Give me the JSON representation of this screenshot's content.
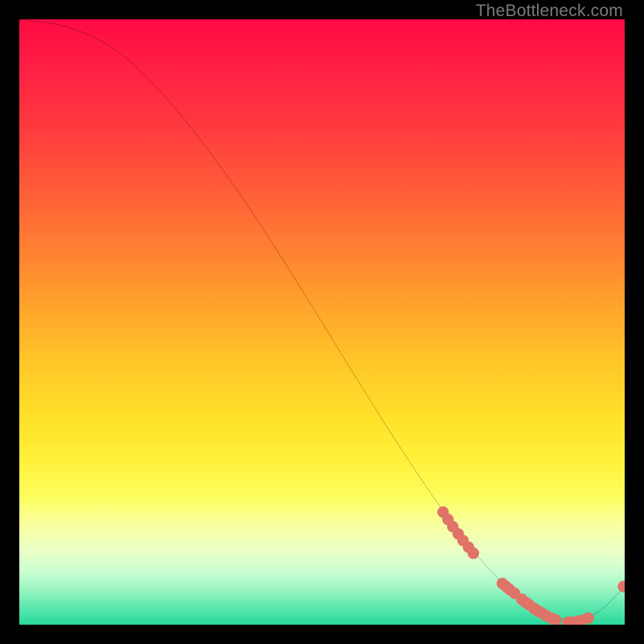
{
  "watermark": "TheBottleneck.com",
  "chart_data": {
    "type": "line",
    "title": "",
    "xlabel": "",
    "ylabel": "",
    "xlim": [
      0,
      100
    ],
    "ylim": [
      0,
      100
    ],
    "grid": false,
    "note": "Axes have no tick labels; values are estimated in 0–100 plot-percent coordinates.",
    "series": [
      {
        "name": "bottleneck-curve",
        "color": "#000000",
        "x": [
          0,
          4,
          8,
          12,
          16,
          20,
          24,
          28,
          32,
          36,
          40,
          44,
          48,
          52,
          56,
          60,
          64,
          68,
          72,
          76,
          80,
          84,
          88,
          92,
          96,
          100
        ],
        "y": [
          100,
          99.6,
          98.8,
          97.3,
          95.0,
          91.6,
          87.4,
          82.6,
          77.4,
          71.8,
          65.8,
          59.6,
          53.2,
          46.7,
          40.2,
          33.8,
          27.6,
          21.6,
          16.0,
          10.9,
          6.6,
          3.3,
          1.2,
          0.5,
          2.0,
          6.4
        ]
      }
    ],
    "markers": {
      "name": "highlighted-points",
      "color": "#e07367",
      "radius_pct": 0.95,
      "points": [
        {
          "x": 70.0,
          "y": 18.6
        },
        {
          "x": 70.8,
          "y": 17.4
        },
        {
          "x": 71.6,
          "y": 16.2
        },
        {
          "x": 72.5,
          "y": 15.0
        },
        {
          "x": 73.3,
          "y": 13.9
        },
        {
          "x": 74.2,
          "y": 12.8
        },
        {
          "x": 75.0,
          "y": 11.8
        },
        {
          "x": 79.8,
          "y": 6.8
        },
        {
          "x": 80.4,
          "y": 6.3
        },
        {
          "x": 81.0,
          "y": 5.8
        },
        {
          "x": 81.8,
          "y": 5.2
        },
        {
          "x": 83.0,
          "y": 4.2
        },
        {
          "x": 83.6,
          "y": 3.7
        },
        {
          "x": 84.2,
          "y": 3.3
        },
        {
          "x": 85.0,
          "y": 2.7
        },
        {
          "x": 85.6,
          "y": 2.3
        },
        {
          "x": 86.2,
          "y": 2.0
        },
        {
          "x": 87.0,
          "y": 1.5
        },
        {
          "x": 87.8,
          "y": 1.1
        },
        {
          "x": 88.6,
          "y": 0.8
        },
        {
          "x": 90.6,
          "y": 0.4
        },
        {
          "x": 91.2,
          "y": 0.4
        },
        {
          "x": 92.0,
          "y": 0.5
        },
        {
          "x": 92.8,
          "y": 0.7
        },
        {
          "x": 94.0,
          "y": 1.1
        },
        {
          "x": 99.8,
          "y": 6.3
        }
      ]
    },
    "background_gradient_stops": [
      {
        "pos": 0.0,
        "color": "#ff0b44"
      },
      {
        "pos": 0.32,
        "color": "#ff6a36"
      },
      {
        "pos": 0.66,
        "color": "#ffe22a"
      },
      {
        "pos": 0.84,
        "color": "#f7ffa6"
      },
      {
        "pos": 1.0,
        "color": "#28d99c"
      }
    ]
  }
}
